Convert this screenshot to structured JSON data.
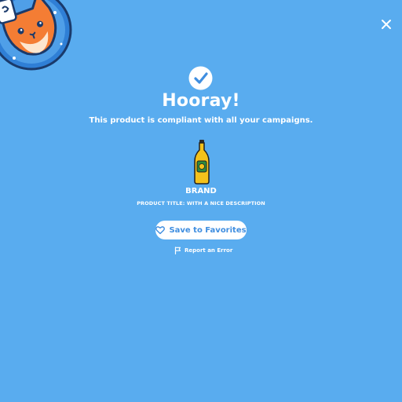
{
  "header": {
    "mascot_icon": "cat-mascot-icon",
    "close_icon": "close-icon"
  },
  "result": {
    "status_icon": "checkmark-circle-icon",
    "title": "Hooray!",
    "subtitle": "This product is compliant with all your campaigns."
  },
  "product": {
    "image_icon": "bottle-icon",
    "brand": "BRAND",
    "title": "PRODUCT TITLE: WITH A NICE DESCRIPTION"
  },
  "actions": {
    "save_label": "Save to Favorites",
    "save_icon": "heart-icon",
    "report_label": "Report an Error",
    "report_icon": "flag-icon"
  },
  "colors": {
    "background": "#59acef",
    "button_text": "#3f8ee0",
    "text": "#ffffff"
  }
}
